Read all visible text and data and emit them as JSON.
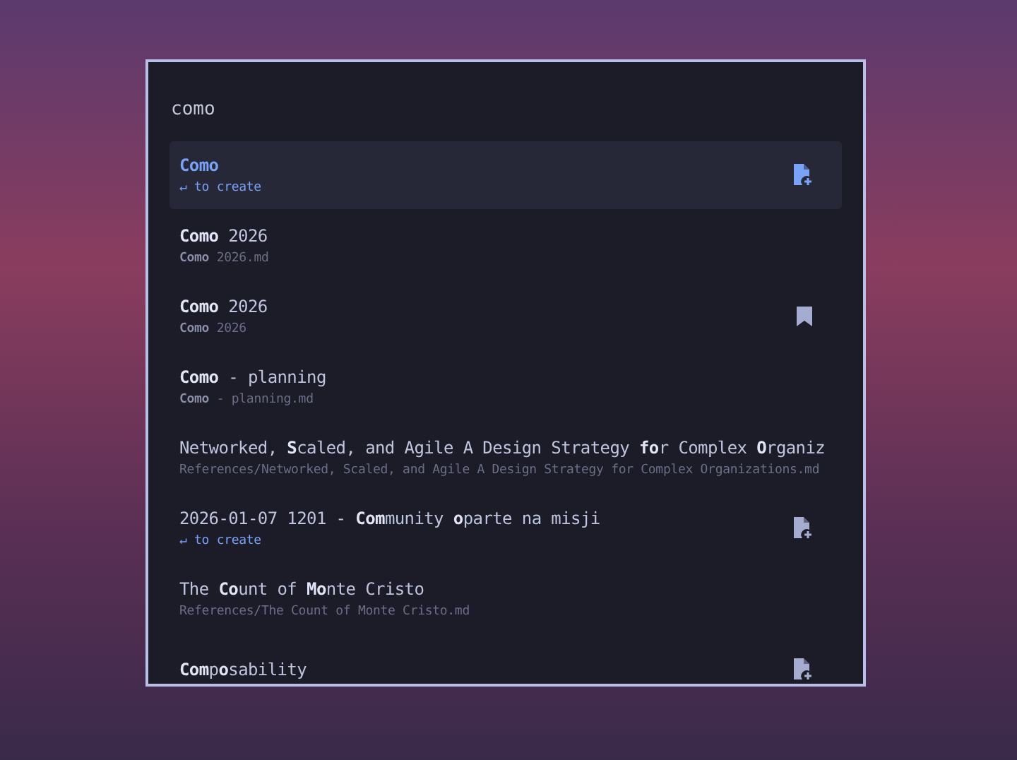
{
  "search": {
    "value": "como"
  },
  "results": [
    {
      "title": "Como",
      "subtitle": "↵ to create",
      "kind": "create",
      "selected": true
    },
    {
      "title": "**Como** 2026",
      "subtitle": "**Como** 2026.md",
      "kind": "note",
      "selected": false
    },
    {
      "title": "**Como** 2026",
      "subtitle": "**Como** 2026",
      "kind": "bookmark",
      "selected": false
    },
    {
      "title": "**Como** - planning",
      "subtitle": "**Como** - planning.md",
      "kind": "note",
      "selected": false
    },
    {
      "title": "Networked, **S**caled, and Agile A Design Strategy **fo**r Complex **O**rganiz",
      "subtitle": "References/Networked, Scaled, and Agile A Design Strategy for Complex Organizations.md",
      "kind": "note",
      "selected": false
    },
    {
      "title": "2026-01-07 1201 - **Com**munity **o**parte na misji",
      "subtitle": "↵ to create",
      "kind": "create",
      "selected": false
    },
    {
      "title": "The **Co**unt of **Mo**nte Cristo",
      "subtitle": "References/The Count of Monte Cristo.md",
      "kind": "note",
      "selected": false
    },
    {
      "title": "**Com**p**o**sability",
      "kind": "create",
      "selected": false
    }
  ]
}
